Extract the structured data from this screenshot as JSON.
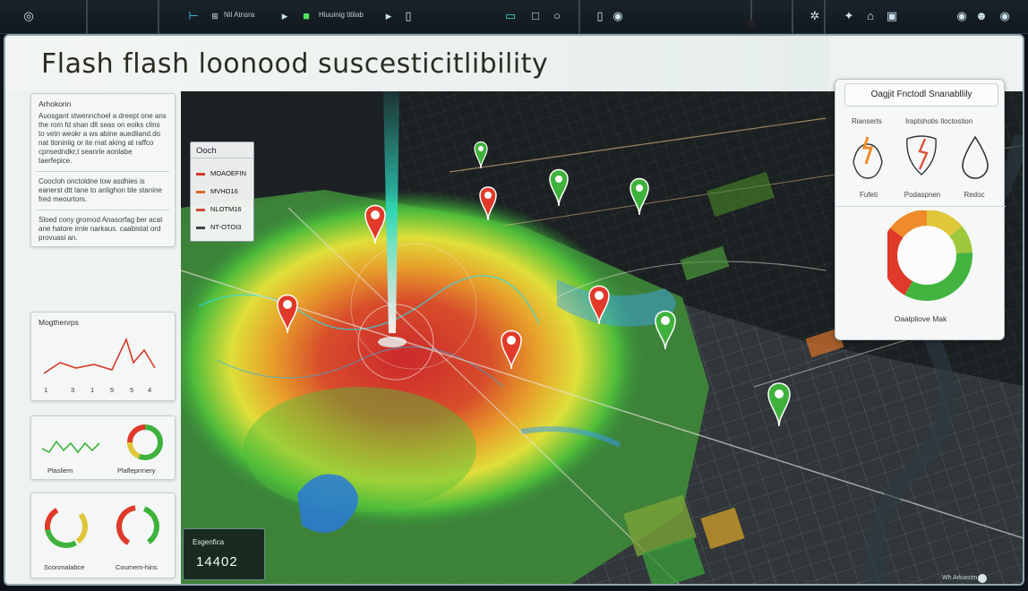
{
  "topbar": {
    "label_left": "Nil Atnsra",
    "label_center": "Hiuuinig titilab"
  },
  "page": {
    "title": "Flash  flash loonood   suscesticitlibility"
  },
  "left_panel": {
    "info": {
      "heading": "Arhokorin",
      "p1": "Auosgant stwennchoel a dreept one ans the rom fd shan dlt seas on eoiks clins to vetn weokr a ws abine auedliand.do nat tloniniig or ite mat aking at raffco cpnsedndkr,t seanrle aonlabe taerfepice.",
      "p2": "Coocloh onctoldne tow asdhies is eanerst dtt tane to anlighon ble stanine fred meourtors.",
      "p3": "Sloed cony gromod Anasorfag ber acat ane hatore irnle narkaus. caabistat ord provuasi an."
    },
    "trend": {
      "heading": "Mogthenrps",
      "ticks": [
        "1",
        "3",
        "1",
        "5",
        "5",
        "4"
      ]
    },
    "row1": {
      "left_label": "Plasliem",
      "right_label": "Plafleprrnery"
    },
    "row2": {
      "left_label": "Sconmalabce",
      "right_label": "Coumem-hins"
    }
  },
  "legend": {
    "title": "Ooch",
    "rows": [
      {
        "label": "MOAOEFIN",
        "color": "#d33a2c"
      },
      {
        "label": "MVHO16",
        "color": "#e06a2a"
      },
      {
        "label": "NLOTM16",
        "color": "#cf4a3a"
      },
      {
        "label": "NT-OTOI3",
        "color": "#e9ecea"
      }
    ]
  },
  "stat": {
    "label": "Esgenfica",
    "value": "14402"
  },
  "right_panel": {
    "title": "Oagjit Fnctodl Snanabllily",
    "sub_left": "Rianserts",
    "sub_right": "Iraptshotis Iloctostion",
    "icons": [
      {
        "name": "flame",
        "label": "Fufeti"
      },
      {
        "name": "shield-crack",
        "label": "Podaspnen"
      },
      {
        "name": "drop",
        "label": "Redoc"
      }
    ],
    "donut_label": "Oaalpliove Mak",
    "donut_segments": [
      {
        "color": "#e0c73a",
        "value": 0.14
      },
      {
        "color": "#9ec83b",
        "value": 0.1
      },
      {
        "color": "#43b43f",
        "value": 0.34
      },
      {
        "color": "#df3a2a",
        "value": 0.27
      },
      {
        "color": "#ef8b2a",
        "value": 0.15
      }
    ]
  },
  "footer": {
    "text": "Wh Arkiastm"
  },
  "colors": {
    "accent": "#2ed8c0",
    "high_risk": "#d8352a",
    "low_risk": "#3fb23d"
  }
}
